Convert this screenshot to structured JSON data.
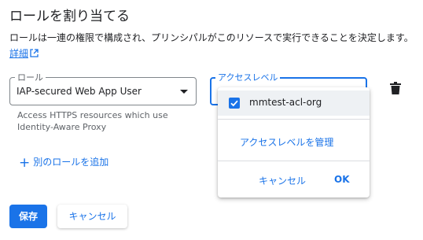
{
  "dialog": {
    "title": "ロールを割り当てる",
    "description": "ロールは一連の権限で構成され、プリンシパルがこのリソースで実行できることを決定します。",
    "details_link": "詳細"
  },
  "role_field": {
    "label": "ロール",
    "value": "IAP-secured Web App User",
    "help": "Access HTTPS resources which use Identity-Aware Proxy"
  },
  "access_field": {
    "label": "アクセスレベル",
    "options": [
      {
        "label": "mmtest-acl-org",
        "checked": true
      }
    ],
    "manage_link": "アクセスレベルを管理",
    "cancel_label": "キャンセル",
    "ok_label": "OK"
  },
  "add_role": {
    "plus": "+",
    "label": "別のロールを追加"
  },
  "footer": {
    "save_label": "保存",
    "cancel_label": "キャンセル"
  },
  "colors": {
    "accent": "#1a73e8",
    "text": "#202124",
    "muted": "#5f6368"
  },
  "icons": [
    "external-link-icon",
    "chevron-down-icon",
    "delete-icon",
    "checkbox-checked-icon",
    "plus-icon"
  ]
}
